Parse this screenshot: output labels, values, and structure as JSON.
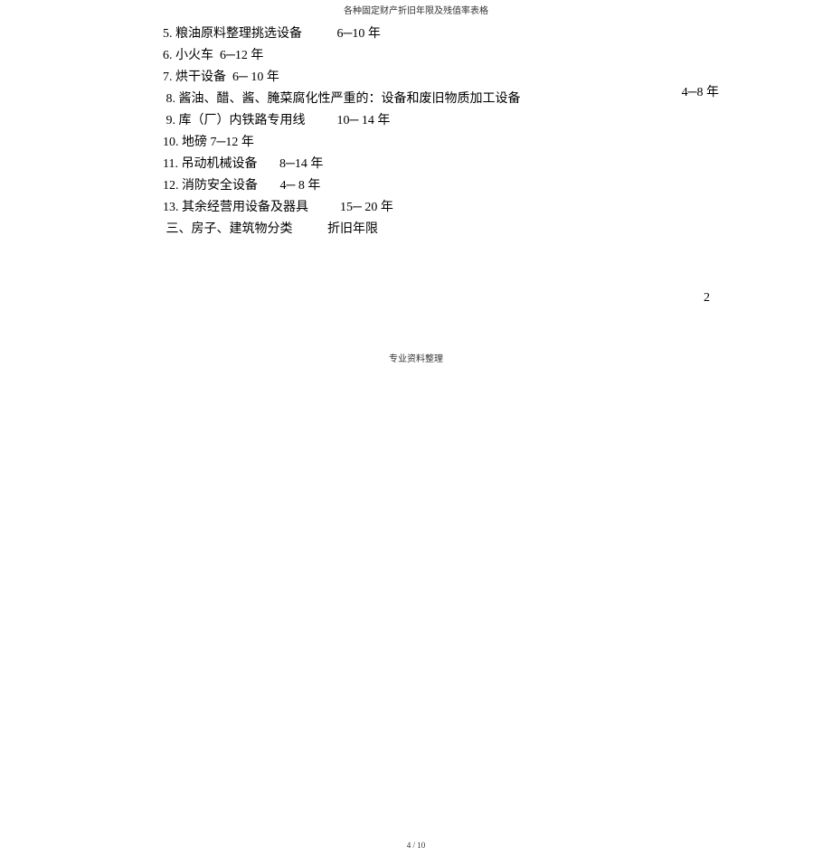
{
  "header": {
    "title": "各种固定财产折旧年限及残值率表格"
  },
  "lines": {
    "l5": "5. 粮油原料整理挑选设备           6─10 年",
    "l6": "6. 小火车  6─12 年",
    "l7": "7. 烘干设备  6─ 10 年",
    "l8_left": " 8. 酱油、醋、酱、腌菜腐化性严重的：设备和废旧物质加工设备",
    "l8_right": "4─8 年",
    "l9": " 9. 库（厂）内铁路专用线          10─ 14 年",
    "l10": "10. 地磅 7─12 年",
    "l11": "11. 吊动机械设备       8─14 年",
    "l12": "12. 消防安全设备       4─ 8 年",
    "l13": "13. 其余经营用设备及器具          15─ 20 年",
    "section": " 三、房子、建筑物分类           折旧年限"
  },
  "page_marker": "2",
  "footer1": "专业资料整理",
  "footer2": "4 / 10"
}
